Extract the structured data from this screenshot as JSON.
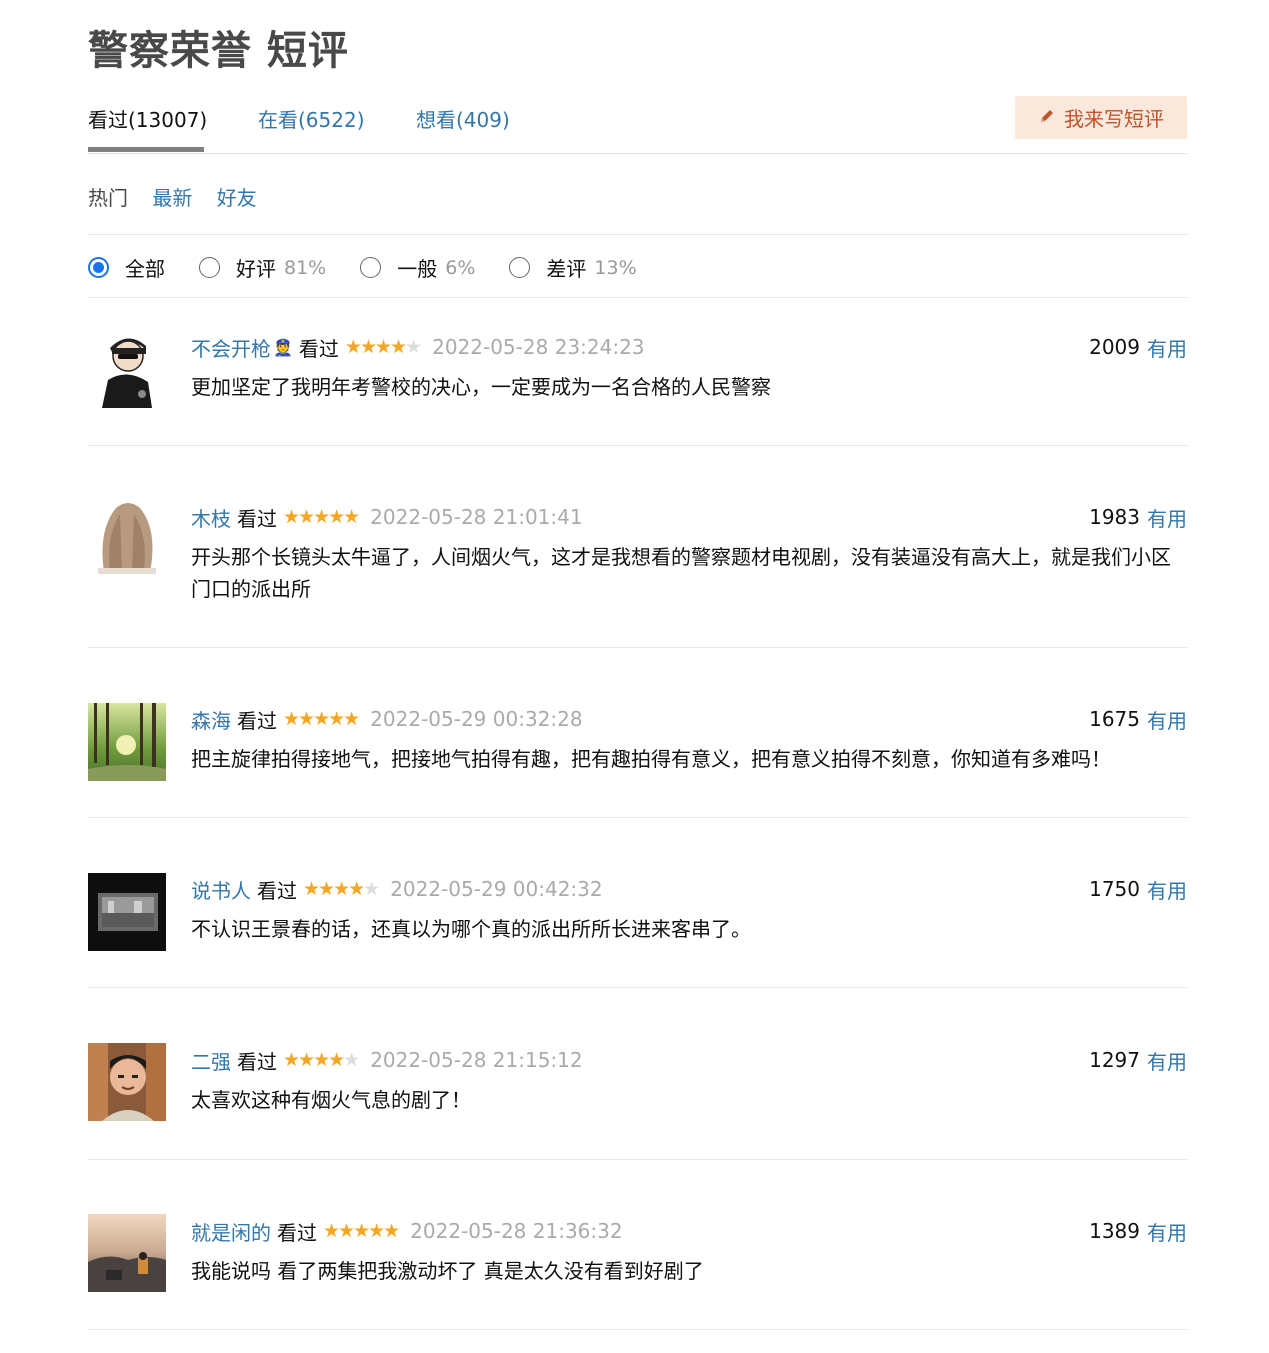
{
  "page_title": "警察荣誉 短评",
  "tabs": [
    {
      "label": "看过(13007)"
    },
    {
      "label": "在看(6522)"
    },
    {
      "label": "想看(409)"
    }
  ],
  "write_button": {
    "label": "我来写短评",
    "icon": "pencil-icon"
  },
  "sort": {
    "hot": "热门",
    "latest": "最新",
    "friends": "好友"
  },
  "filters": [
    {
      "label": "全部",
      "pct": "",
      "checked": true
    },
    {
      "label": "好评",
      "pct": "81%",
      "checked": false
    },
    {
      "label": "一般",
      "pct": "6%",
      "checked": false
    },
    {
      "label": "差评",
      "pct": "13%",
      "checked": false
    }
  ],
  "colors": {
    "link": "#3377aa",
    "star": "#f5a623",
    "radio": "#1a73e8",
    "button_bg": "#fbe8dd",
    "button_text": "#c0542a"
  },
  "comments": [
    {
      "user": "不会开枪",
      "badge": "👮",
      "status": "看过",
      "rating": 4,
      "time": "2022-05-28 23:24:23",
      "votes": "2009",
      "useful": "有用",
      "text": "更加坚定了我明年考警校的决心，一定要成为一名合格的人民警察"
    },
    {
      "user": "木枝",
      "badge": "",
      "status": "看过",
      "rating": 5,
      "time": "2022-05-28 21:01:41",
      "votes": "1983",
      "useful": "有用",
      "text": "开头那个长镜头太牛逼了，人间烟火气，这才是我想看的警察题材电视剧，没有装逼没有高大上，就是我们小区门口的派出所"
    },
    {
      "user": "森海",
      "badge": "",
      "status": "看过",
      "rating": 5,
      "time": "2022-05-29 00:32:28",
      "votes": "1675",
      "useful": "有用",
      "text": "把主旋律拍得接地气，把接地气拍得有趣，把有趣拍得有意义，把有意义拍得不刻意，你知道有多难吗！"
    },
    {
      "user": "说书人",
      "badge": "",
      "status": "看过",
      "rating": 4,
      "time": "2022-05-29 00:42:32",
      "votes": "1750",
      "useful": "有用",
      "text": "不认识王景春的话，还真以为哪个真的派出所所长进来客串了。"
    },
    {
      "user": "二强",
      "badge": "",
      "status": "看过",
      "rating": 4,
      "time": "2022-05-28 21:15:12",
      "votes": "1297",
      "useful": "有用",
      "text": "太喜欢这种有烟火气息的剧了！"
    },
    {
      "user": "就是闲的",
      "badge": "",
      "status": "看过",
      "rating": 5,
      "time": "2022-05-28 21:36:32",
      "votes": "1389",
      "useful": "有用",
      "text": "我能说吗 看了两集把我激动坏了 真是太久没有看到好剧了"
    }
  ]
}
